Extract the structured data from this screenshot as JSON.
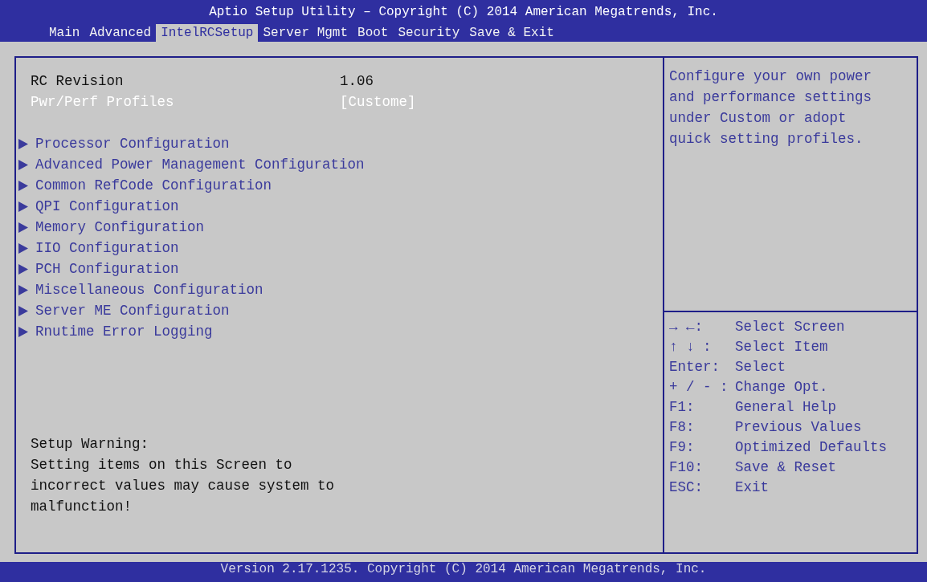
{
  "title": "Aptio Setup Utility – Copyright (C) 2014 American Megatrends, Inc.",
  "tabs": [
    {
      "label": "Main",
      "selected": false
    },
    {
      "label": "Advanced",
      "selected": false
    },
    {
      "label": "IntelRCSetup",
      "selected": true
    },
    {
      "label": "Server Mgmt",
      "selected": false
    },
    {
      "label": "Boot",
      "selected": false
    },
    {
      "label": "Security",
      "selected": false
    },
    {
      "label": "Save & Exit",
      "selected": false
    }
  ],
  "settings": [
    {
      "label": "RC Revision",
      "value": "1.06",
      "selected": false
    },
    {
      "label": "Pwr/Perf Profiles",
      "value": "[Custome]",
      "selected": true
    }
  ],
  "submenus": [
    {
      "label": "Processor Configuration",
      "selected": false
    },
    {
      "label": "Advanced Power Management Configuration",
      "selected": false
    },
    {
      "label": "Common RefCode Configuration",
      "selected": false
    },
    {
      "label": "QPI Configuration",
      "selected": false
    },
    {
      "label": "Memory Configuration",
      "selected": false
    },
    {
      "label": "IIO Configuration",
      "selected": false
    },
    {
      "label": "PCH Configuration",
      "selected": false
    },
    {
      "label": "Miscellaneous Configuration",
      "selected": false
    },
    {
      "label": "Server ME Configuration",
      "selected": false
    },
    {
      "label": "Rnutime Error Logging",
      "selected": false
    }
  ],
  "warning": {
    "title": "Setup Warning:",
    "text": "Setting items on this Screen to incorrect values may cause system to malfunction!"
  },
  "help_lines": [
    "Configure your own power",
    "and performance settings",
    "under Custom or adopt",
    "quick setting profiles."
  ],
  "keys": [
    {
      "key": "→ ←:",
      "action": "Select Screen"
    },
    {
      "key": "↑ ↓ :",
      "action": "Select Item"
    },
    {
      "key": "Enter:",
      "action": "Select"
    },
    {
      "key": "+ / - :",
      "action": "Change Opt."
    },
    {
      "key": "F1:",
      "action": "General Help"
    },
    {
      "key": "F8:",
      "action": "Previous Values"
    },
    {
      "key": "F9:",
      "action": "Optimized Defaults"
    },
    {
      "key": "F10:",
      "action": "Save & Reset"
    },
    {
      "key": "ESC:",
      "action": "Exit"
    }
  ],
  "footer": "Version 2.17.1235. Copyright (C) 2014 American Megatrends, Inc."
}
